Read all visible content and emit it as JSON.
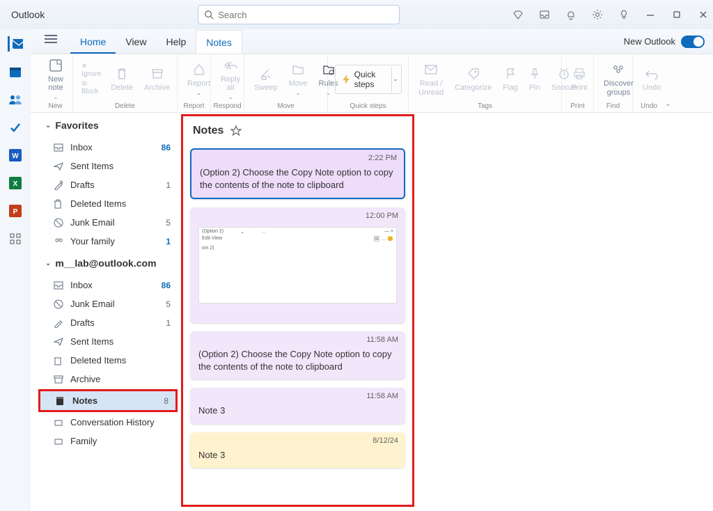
{
  "app_title": "Outlook",
  "search_placeholder": "Search",
  "tabs": {
    "home": "Home",
    "view": "View",
    "help": "Help",
    "notes": "Notes"
  },
  "new_outlook_label": "New Outlook",
  "ribbon": {
    "new_note": "New note",
    "new_note_chevron": "⌄",
    "ignore": "Ignore",
    "block": "Block",
    "delete": "Delete",
    "archive": "Archive",
    "report": "Report",
    "reply_all": "Reply all",
    "sweep": "Sweep",
    "move": "Move",
    "rules": "Rules",
    "quick_steps": "Quick steps",
    "read_unread": "Read / Unread",
    "categorize": "Categorize",
    "flag": "Flag",
    "pin": "Pin",
    "snooze": "Snooze",
    "print": "Print",
    "discover": "Discover groups",
    "undo": "Undo",
    "groups": {
      "new": "New",
      "delete": "Delete",
      "report": "Report",
      "respond": "Respond",
      "move": "Move",
      "quick": "Quick steps",
      "tags": "Tags",
      "print": "Print",
      "find": "Find",
      "undo": "Undo"
    }
  },
  "sidebar": {
    "favorites_label": "Favorites",
    "account_label": "m__lab@outlook.com",
    "fav": [
      {
        "name": "Inbox",
        "count": "86"
      },
      {
        "name": "Sent Items",
        "count": ""
      },
      {
        "name": "Drafts",
        "count": "1"
      },
      {
        "name": "Deleted Items",
        "count": ""
      },
      {
        "name": "Junk Email",
        "count": "5"
      },
      {
        "name": "Your family",
        "count": "1"
      }
    ],
    "acct": [
      {
        "name": "Inbox",
        "count": "86"
      },
      {
        "name": "Junk Email",
        "count": "5"
      },
      {
        "name": "Drafts",
        "count": "1"
      },
      {
        "name": "Sent Items",
        "count": ""
      },
      {
        "name": "Deleted Items",
        "count": ""
      },
      {
        "name": "Archive",
        "count": ""
      },
      {
        "name": "Notes",
        "count": "8"
      },
      {
        "name": "Conversation History",
        "count": ""
      },
      {
        "name": "Family",
        "count": ""
      }
    ]
  },
  "notes": {
    "header": "Notes",
    "items": [
      {
        "time": "2:22 PM",
        "body": "(Option 2) Choose the Copy Note option to copy the contents of the note to clipboard"
      },
      {
        "time": "12:00 PM",
        "body": ""
      },
      {
        "time": "11:58 AM",
        "body": "(Option 2) Choose the Copy Note option to copy the contents of the note to clipboard"
      },
      {
        "time": "11:58 AM",
        "body": "Note 3"
      },
      {
        "time": "8/12/24",
        "body": "Note 3"
      }
    ],
    "mini": {
      "line1": "(Option 2)",
      "line2": "Edit    View",
      "line3": "ion 2)"
    }
  }
}
